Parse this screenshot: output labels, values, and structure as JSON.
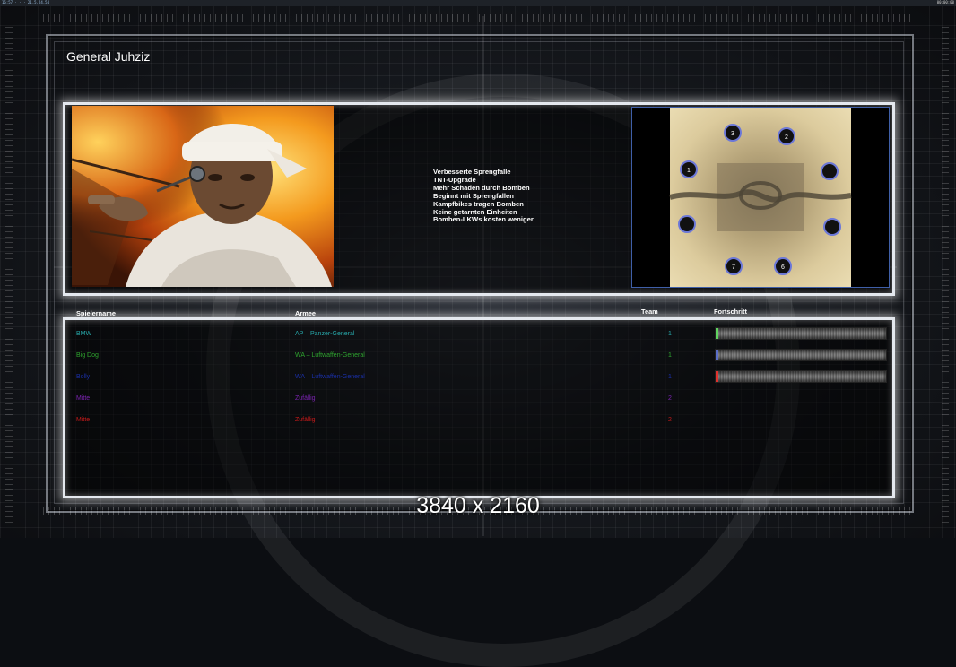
{
  "topbar": {
    "left_text": "16:57 · · · 21.5.24.54",
    "right_text": "00:00:00"
  },
  "title": "General Juhziz",
  "features": [
    "Verbesserte Sprengfalle",
    "TNT-Upgrade",
    "Mehr Schaden durch Bomben",
    "Beginnt mit Sprengfallen",
    "Kampfbikes tragen Bomben",
    "Keine getarnten Einheiten",
    "Bomben-LKWs kosten weniger"
  ],
  "minimap": {
    "start_positions": [
      "1",
      "2",
      "3",
      "",
      "",
      "",
      "6",
      "7"
    ]
  },
  "table": {
    "headers": {
      "name": "Spielername",
      "army": "Armee",
      "team": "Team",
      "progress": "Fortschritt"
    },
    "rows": [
      {
        "name": "BMW",
        "army": "AP – Panzer-General",
        "team": "1",
        "color": "#27a6a8",
        "progress_color": "#5fd35f"
      },
      {
        "name": "Big Dog",
        "army": "WA – Luftwaffen-General",
        "team": "1",
        "color": "#2fa52f",
        "progress_color": "#5a6ec8"
      },
      {
        "name": "Bolly",
        "army": "WA – Luftwaffen-General",
        "team": "1",
        "color": "#1a2fa6",
        "progress_color": "#e0322e"
      },
      {
        "name": "Mitte",
        "army": "Zufällig",
        "team": "2",
        "color": "#7a23b0",
        "progress_color": ""
      },
      {
        "name": "Mitte",
        "army": "Zufällig",
        "team": "2",
        "color": "#c41a1a",
        "progress_color": ""
      }
    ]
  },
  "resolution_label": "3840 x 2160"
}
